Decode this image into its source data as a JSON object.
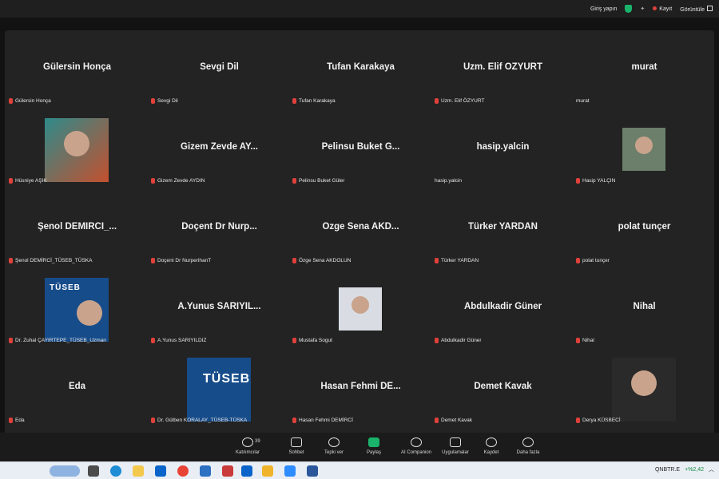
{
  "topbar": {
    "sign_in": "Giriş yapın",
    "record": "Kayıt",
    "view": "Görüntüle"
  },
  "tiles": [
    {
      "big": "Gülersin Honça",
      "label": "Gülersin Honça",
      "muted": true
    },
    {
      "big": "Sevgi Dil",
      "label": "Sevgi Dil",
      "muted": true
    },
    {
      "big": "Tufan Karakaya",
      "label": "Tufan Karakaya",
      "muted": true
    },
    {
      "big": "Uzm. Elif ÖZYURT",
      "label": "Uzm. Elif ÖZYURT",
      "muted": true
    },
    {
      "big": "murat",
      "label": "murat",
      "muted": false
    },
    {
      "big": "",
      "label": "Hüsniye AŞIK",
      "muted": true,
      "video": "woman"
    },
    {
      "big": "Gizem Zevde AY...",
      "label": "Gizem Zevde AYDIN",
      "muted": true
    },
    {
      "big": "Pelinsu Buket G...",
      "label": "Pelinsu Buket Güler",
      "muted": true
    },
    {
      "big": "hasip.yalcin",
      "label": "hasip.yalcin",
      "muted": false
    },
    {
      "big": "",
      "label": "Hasip YALÇIN",
      "muted": true,
      "video": "man-small"
    },
    {
      "big": "Şenol  DEMİRCİ_...",
      "label": "Şenol DEMİRCİ_TÜSEB_TÜSKA",
      "muted": true
    },
    {
      "big": "Doçent Dr Nurp...",
      "label": "Doçent Dr NurperihanT",
      "muted": true
    },
    {
      "big": "Özge Sena AKD...",
      "label": "Özge Sena AKDOLUN",
      "muted": true
    },
    {
      "big": "Türker YARDAN",
      "label": "Türker YARDAN",
      "muted": true
    },
    {
      "big": "polat tunçer",
      "label": "polat tunçer",
      "muted": true
    },
    {
      "big": "",
      "label": "Dr. Zuhal ÇAYIRTEPE_TÜSEB_Uzman",
      "muted": true,
      "video": "tuseb-woman"
    },
    {
      "big": "A.Yunus SARIYIL...",
      "label": "A.Yunus SARIYILDIZ",
      "muted": true
    },
    {
      "big": "",
      "label": "Mustafa Sogut",
      "muted": true,
      "video": "man-suit"
    },
    {
      "big": "Abdulkadir Güner",
      "label": "Abdulkadir Güner",
      "muted": true
    },
    {
      "big": "Nihal",
      "label": "Nihal",
      "muted": true
    },
    {
      "big": "Eda",
      "label": "Eda",
      "muted": true
    },
    {
      "big": "",
      "label": "Dr. Gülben KORALAY_TÜSEB-TÜSKA",
      "muted": true,
      "video": "tuseb"
    },
    {
      "big": "Hasan Fehmi DE...",
      "label": "Hasan Fehmi DEMİRCİ",
      "muted": true
    },
    {
      "big": "Demet Kavak",
      "label": "Demet Kavak",
      "muted": true
    },
    {
      "big": "",
      "label": "Derya KÜSBECİ",
      "muted": true,
      "video": "woman-dark"
    }
  ],
  "tuseb_logo": "TÜSEB",
  "toolbar": {
    "participants": "Katılımcılar",
    "participants_count": "39",
    "chat": "Sohbet",
    "reactions": "Tepki ver",
    "share": "Paylaş",
    "ai": "AI Companion",
    "apps": "Uygulamalar",
    "record": "Kaydet",
    "more": "Daha fazla"
  },
  "taskbar": {
    "ticker": "QNBTR.E",
    "change": "+%2,42"
  },
  "colors": {
    "accent_green": "#19b36b",
    "mute_red": "#e0413a",
    "tuseb_blue": "#174c8a"
  }
}
